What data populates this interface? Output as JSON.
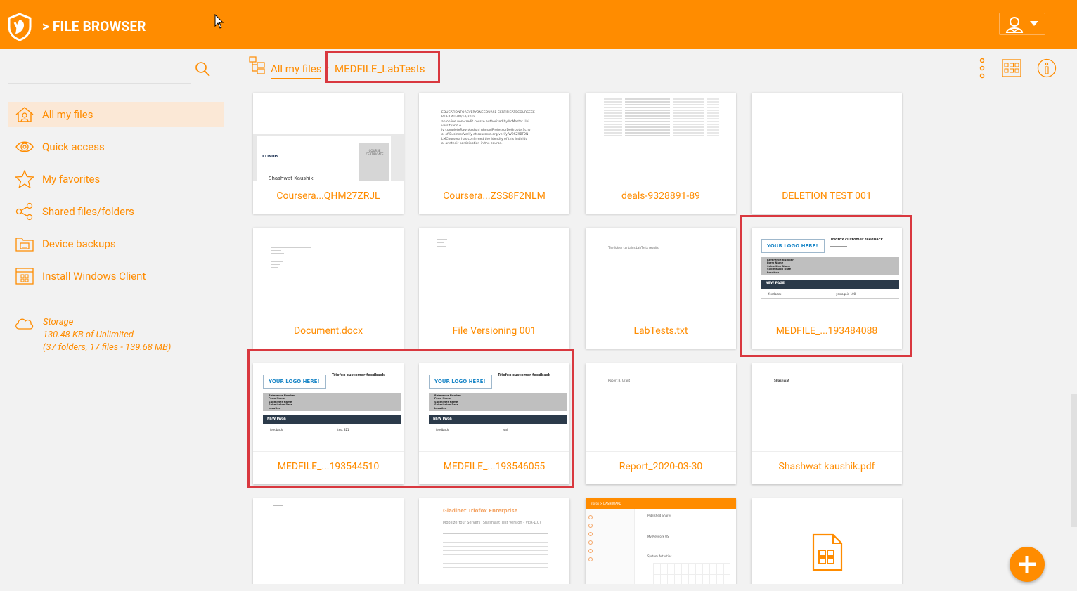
{
  "header": {
    "title": "> FILE BROWSER",
    "logo_icon": "shield-logo-icon",
    "user_menu_icon": "user-icon",
    "brand_color": "#ff8c00"
  },
  "sidebar": {
    "search_icon": "search-icon",
    "items": [
      {
        "label": "All my files",
        "icon": "home-icon",
        "active": true
      },
      {
        "label": "Quick access",
        "icon": "eye-icon",
        "active": false
      },
      {
        "label": "My favorites",
        "icon": "star-icon",
        "active": false
      },
      {
        "label": "Shared files/folders",
        "icon": "share-icon",
        "active": false
      },
      {
        "label": "Device backups",
        "icon": "device-icon",
        "active": false
      },
      {
        "label": "Install Windows Client",
        "icon": "windows-client-icon",
        "active": false
      }
    ],
    "storage": {
      "label": "Storage",
      "used": "130.48 KB of Unlimited",
      "summary": "(37 folders, 17 files - 139.68 MB)"
    }
  },
  "breadcrumb": {
    "root": "All my files",
    "separator": "›",
    "current": "MEDFILE_LabTests"
  },
  "toolbar": {
    "more_icon": "kebab-icon",
    "view_icon": "grid-view-icon",
    "info_icon": "info-icon"
  },
  "thumb_text": {
    "illinois": "ILLINOIS",
    "course_certificate": "COURSE CERTIFICATE",
    "cert_name": "Shashwat Kaushik",
    "cert_lines": [
      "EDUCATIONFOREVERYONECOURSE CERTIFICATECOURSECE",
      "RTIFICATE08/14/2019",
      "an online non-credit course authorized byMcMaster Uni",
      "versityand o",
      "ly completeRawnArshad AhmadProfessorDeGroote Scho",
      "ol of BusinessVerify at coursera.org/verify/W9SZ9BF2N",
      "LMCoursera has confirmed the identity of this individu",
      "al andtheir participation in the course."
    ],
    "lab_text": "The folder contains LabTests results",
    "logo_here": "YOUR LOGO HERE!",
    "feedback_title": "Triofox customer feedback",
    "new_page": "NEW PAGE",
    "feedback_label": "feedback",
    "form_rows": [
      "Reference Number",
      "Form Name",
      "Submitter Name",
      "Submission Date",
      "Location"
    ],
    "report_text": "Robert B. Grant",
    "shashwat_text": "Shashwat",
    "doc_title": "Gladinet Triofox Enterprise",
    "doc_subtitle": "Mobilize Your Servers (Shashwat Test Version - VER-1.0)",
    "dash_brand": "Triofox > DASHBOARD",
    "dash_heading": "Published Shares",
    "dash_sub": "My Network US",
    "dash_activity": "System Activities"
  },
  "files": [
    {
      "name": "Coursera...QHM27ZRJL",
      "thumb": "certificate"
    },
    {
      "name": "Coursera...ZSS8F2NLM",
      "thumb": "textcert"
    },
    {
      "name": "deals-9328891-89",
      "thumb": "spreadsheet"
    },
    {
      "name": "DELETION TEST 001",
      "thumb": "blank"
    },
    {
      "name": "Document.docx",
      "thumb": "doclines"
    },
    {
      "name": "File Versioning 001",
      "thumb": "shortlines"
    },
    {
      "name": "LabTests.txt",
      "thumb": "labtext"
    },
    {
      "name": "MEDFILE_...193484088",
      "thumb": "form",
      "value": "yes again 100"
    },
    {
      "name": "MEDFILE_...193544510",
      "thumb": "form",
      "value": "test 321"
    },
    {
      "name": "MEDFILE_...193546055",
      "thumb": "form",
      "value": "val"
    },
    {
      "name": "Report_2020-03-30",
      "thumb": "report"
    },
    {
      "name": "Shashwat kaushik.pdf",
      "thumb": "shashwat"
    },
    {
      "name": "",
      "thumb": "smalltext"
    },
    {
      "name": "",
      "thumb": "orangedoc"
    },
    {
      "name": "",
      "thumb": "dashboard"
    },
    {
      "name": "",
      "thumb": "excel"
    }
  ],
  "fab": {
    "icon": "plus-icon"
  }
}
